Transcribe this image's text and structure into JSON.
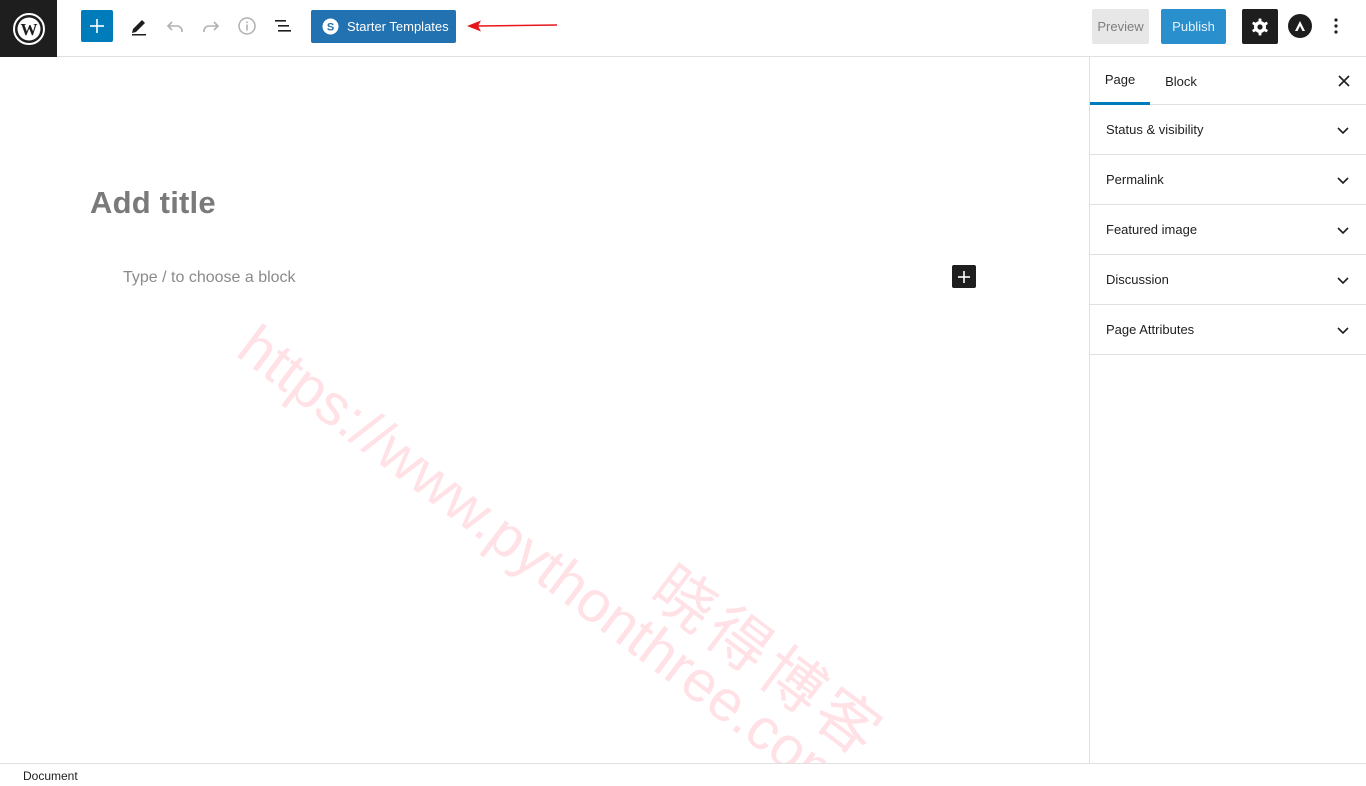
{
  "toolbar": {
    "wp_logo_icon": "wordpress-logo-icon",
    "add_block_icon": "plus-icon",
    "tools_icon": "pencil-icon",
    "undo_icon": "undo-icon",
    "redo_icon": "redo-icon",
    "details_icon": "info-icon",
    "list_view_icon": "list-view-icon",
    "starter_templates_label": "Starter Templates",
    "starter_templates_icon": "starter-templates-icon",
    "preview_label": "Preview",
    "publish_label": "Publish",
    "settings_icon": "gear-icon",
    "astra_icon": "astra-logo-icon",
    "more_icon": "vertical-dots-icon"
  },
  "annotation": {
    "color": "#e8151b",
    "icon": "red-arrow-icon"
  },
  "editor": {
    "title_placeholder": "Add title",
    "block_placeholder": "Type / to choose a block"
  },
  "watermark": {
    "url": "https://www.pythonthree.com",
    "name": "晓得博客"
  },
  "sidebar": {
    "tabs": [
      {
        "label": "Page",
        "active": true
      },
      {
        "label": "Block",
        "active": false
      }
    ],
    "panels": [
      {
        "label": "Status & visibility"
      },
      {
        "label": "Permalink"
      },
      {
        "label": "Featured image"
      },
      {
        "label": "Discussion"
      },
      {
        "label": "Page Attributes"
      }
    ]
  },
  "footer": {
    "breadcrumb": "Document"
  },
  "colors": {
    "accent": "#007cba",
    "starter_button": "#2271b1",
    "dark": "#1e1e1e"
  }
}
